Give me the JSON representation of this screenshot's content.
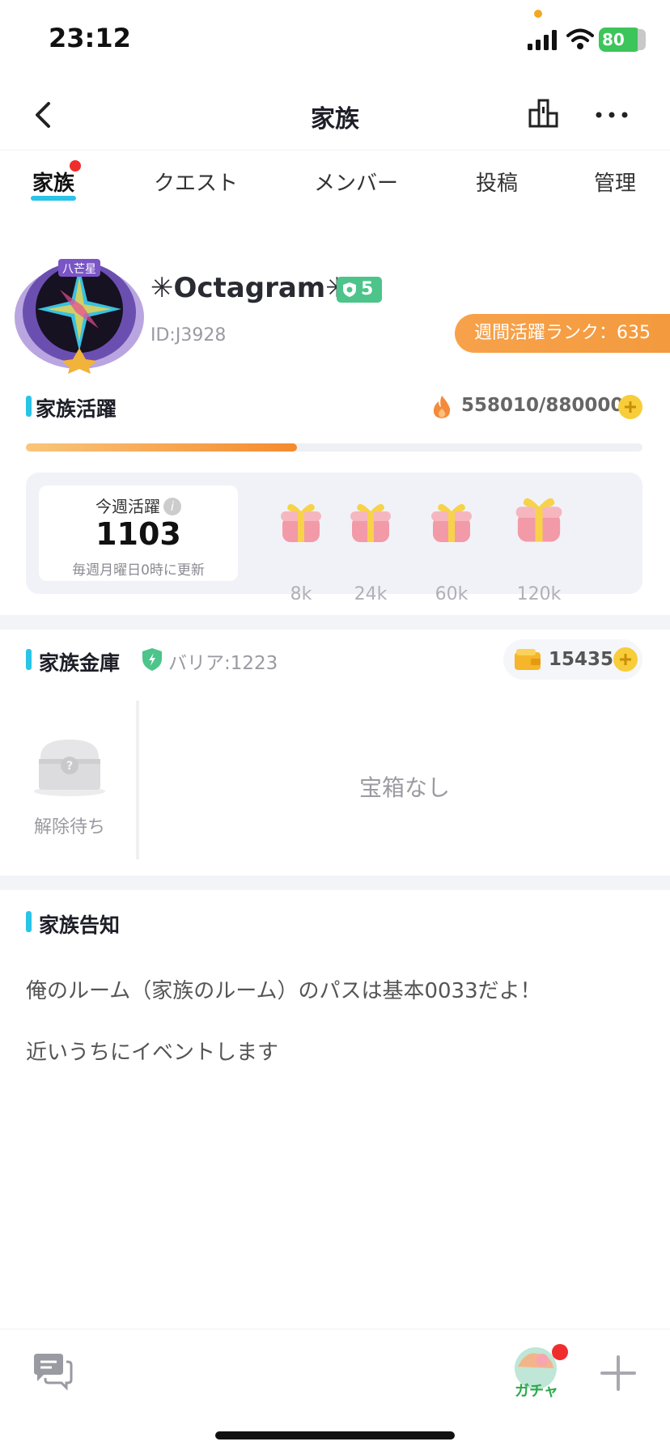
{
  "status_bar": {
    "time": "23:12",
    "battery": "80"
  },
  "header": {
    "title": "家族"
  },
  "tabs": [
    {
      "label": "家族",
      "active": true,
      "has_badge": true
    },
    {
      "label": "クエスト"
    },
    {
      "label": "メンバー"
    },
    {
      "label": "投稿"
    },
    {
      "label": "管理"
    }
  ],
  "family": {
    "name": "✳Octagram✳",
    "level": "5",
    "id": "ID:J3928",
    "rank": "週間活躍ランク：635",
    "avatar_icon": "family-emblem-icon"
  },
  "activity": {
    "title": "家族活躍",
    "count": "558010/880000",
    "progress": 0.44,
    "weekly_label": "今週活躍",
    "weekly_value": "1103",
    "weekly_note": "毎週月曜日0時に更新",
    "gifts": [
      "8k",
      "24k",
      "60k",
      "120k"
    ]
  },
  "vault": {
    "title": "家族金庫",
    "barrier": "バリア:1223",
    "coins": "15435",
    "chest_label": "解除待ち",
    "empty": "宝箱なし"
  },
  "notice": {
    "title": "家族告知",
    "lines": [
      "俺のルーム（家族のルーム）のパスは基本0033だよ！",
      "近いうちにイベントします"
    ]
  },
  "bottom": {
    "gacha_label": "ガチャ"
  },
  "colors": {
    "accent": "#29c4e8",
    "orange": "#f39a3e",
    "green": "#4cc48a",
    "badge_red": "#f02d2d"
  }
}
